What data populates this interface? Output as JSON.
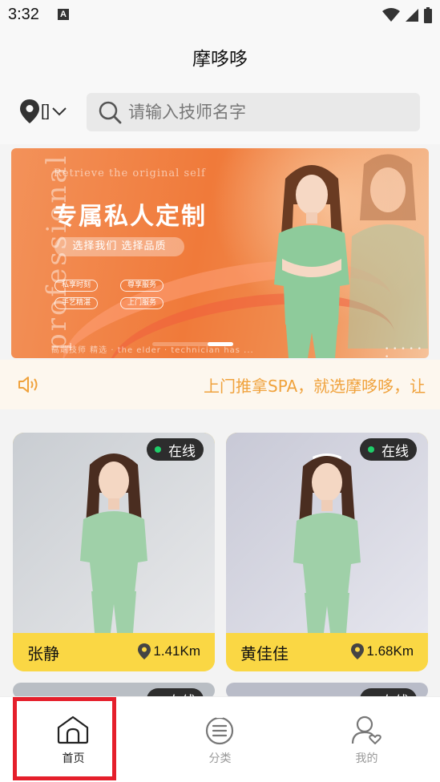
{
  "status_bar": {
    "time": "3:32",
    "notification_icon": "A"
  },
  "header": {
    "title": "摩哆哆"
  },
  "location": {
    "value": "[]"
  },
  "search": {
    "placeholder": "请输入技师名字"
  },
  "banner": {
    "subtitle": "Retrieve the original self",
    "vertical_text": "professional",
    "headline": "专属私人定制",
    "pill": "选择我们 选择品质",
    "tags": [
      "私享时刻",
      "尊享服务",
      "手艺精湛",
      "上门服务"
    ],
    "caption": "高端技师 精选 · the elder · technician has ...",
    "dots": "• • • • • •"
  },
  "announcement": {
    "text": "上门推拿SPA，就选摩哆哆，让"
  },
  "therapists": [
    {
      "name": "张静",
      "distance": "1.41Km",
      "status": "在线"
    },
    {
      "name": "黄佳佳",
      "distance": "1.68Km",
      "status": "在线"
    },
    {
      "name": "",
      "distance": "",
      "status": "在线"
    },
    {
      "name": "",
      "distance": "",
      "status": "在线"
    }
  ],
  "tabs": [
    {
      "label": "首页",
      "icon": "home-icon",
      "active": true
    },
    {
      "label": "分类",
      "icon": "category-icon",
      "active": false
    },
    {
      "label": "我的",
      "icon": "profile-icon",
      "active": false
    }
  ],
  "colors": {
    "accent": "#fad744",
    "badge_bg": "#2d2d2d",
    "online": "#1fcf6a",
    "highlight": "#e51f2b",
    "marquee_text": "#f0a23c"
  }
}
